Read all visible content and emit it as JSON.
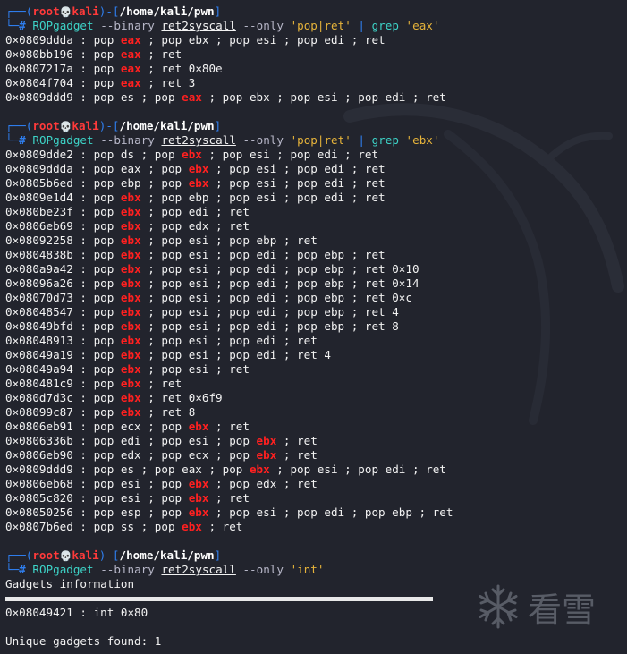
{
  "prompt": {
    "user": "root",
    "skull": "💀",
    "host": "kali",
    "path": "/home/kali/pwn",
    "top_prefix": "┌──(",
    "top_after_host": ")-[",
    "top_suffix": "]",
    "bottom_prefix": "└─",
    "hash": "#"
  },
  "commands": [
    {
      "program": "ROPgadget",
      "flag_binary": "--binary",
      "binary": "ret2syscall",
      "flag_only": "--only",
      "only_value": "'pop|ret'",
      "pipe": "|",
      "grep": "grep",
      "grep_value": "'eax'"
    },
    {
      "program": "ROPgadget",
      "flag_binary": "--binary",
      "binary": "ret2syscall",
      "flag_only": "--only",
      "only_value": "'pop|ret'",
      "pipe": "|",
      "grep": "grep",
      "grep_value": "'ebx'"
    },
    {
      "program": "ROPgadget",
      "flag_binary": "--binary",
      "binary": "ret2syscall",
      "flag_only": "--only",
      "only_value": "'int'"
    }
  ],
  "eax_results": [
    [
      "0×0809ddda : pop ",
      "eax",
      " ; pop ebx ; pop esi ; pop edi ; ret"
    ],
    [
      "0×080bb196 : pop ",
      "eax",
      " ; ret"
    ],
    [
      "0×0807217a : pop ",
      "eax",
      " ; ret 0×80e"
    ],
    [
      "0×0804f704 : pop ",
      "eax",
      " ; ret 3"
    ],
    [
      "0×0809ddd9 : pop es ; pop ",
      "eax",
      " ; pop ebx ; pop esi ; pop edi ; ret"
    ]
  ],
  "ebx_results": [
    [
      "0×0809dde2 : pop ds ; pop ",
      "ebx",
      " ; pop esi ; pop edi ; ret"
    ],
    [
      "0×0809ddda : pop eax ; pop ",
      "ebx",
      " ; pop esi ; pop edi ; ret"
    ],
    [
      "0×0805b6ed : pop ebp ; pop ",
      "ebx",
      " ; pop esi ; pop edi ; ret"
    ],
    [
      "0×0809e1d4 : pop ",
      "ebx",
      " ; pop ebp ; pop esi ; pop edi ; ret"
    ],
    [
      "0×080be23f : pop ",
      "ebx",
      " ; pop edi ; ret"
    ],
    [
      "0×0806eb69 : pop ",
      "ebx",
      " ; pop edx ; ret"
    ],
    [
      "0×08092258 : pop ",
      "ebx",
      " ; pop esi ; pop ebp ; ret"
    ],
    [
      "0×0804838b : pop ",
      "ebx",
      " ; pop esi ; pop edi ; pop ebp ; ret"
    ],
    [
      "0×080a9a42 : pop ",
      "ebx",
      " ; pop esi ; pop edi ; pop ebp ; ret 0×10"
    ],
    [
      "0×08096a26 : pop ",
      "ebx",
      " ; pop esi ; pop edi ; pop ebp ; ret 0×14"
    ],
    [
      "0×08070d73 : pop ",
      "ebx",
      " ; pop esi ; pop edi ; pop ebp ; ret 0×c"
    ],
    [
      "0×08048547 : pop ",
      "ebx",
      " ; pop esi ; pop edi ; pop ebp ; ret 4"
    ],
    [
      "0×08049bfd : pop ",
      "ebx",
      " ; pop esi ; pop edi ; pop ebp ; ret 8"
    ],
    [
      "0×08048913 : pop ",
      "ebx",
      " ; pop esi ; pop edi ; ret"
    ],
    [
      "0×08049a19 : pop ",
      "ebx",
      " ; pop esi ; pop edi ; ret 4"
    ],
    [
      "0×08049a94 : pop ",
      "ebx",
      " ; pop esi ; ret"
    ],
    [
      "0×080481c9 : pop ",
      "ebx",
      " ; ret"
    ],
    [
      "0×080d7d3c : pop ",
      "ebx",
      " ; ret 0×6f9"
    ],
    [
      "0×08099c87 : pop ",
      "ebx",
      " ; ret 8"
    ],
    [
      "0×0806eb91 : pop ecx ; pop ",
      "ebx",
      " ; ret"
    ],
    [
      "0×0806336b : pop edi ; pop esi ; pop ",
      "ebx",
      " ; ret"
    ],
    [
      "0×0806eb90 : pop edx ; pop ecx ; pop ",
      "ebx",
      " ; ret"
    ],
    [
      "0×0809ddd9 : pop es ; pop eax ; pop ",
      "ebx",
      " ; pop esi ; pop edi ; ret"
    ],
    [
      "0×0806eb68 : pop esi ; pop ",
      "ebx",
      " ; pop edx ; ret"
    ],
    [
      "0×0805c820 : pop esi ; pop ",
      "ebx",
      " ; ret"
    ],
    [
      "0×08050256 : pop esp ; pop ",
      "ebx",
      " ; pop esi ; pop edi ; pop ebp ; ret"
    ],
    [
      "0×0807b6ed : pop ss ; pop ",
      "ebx",
      " ; ret"
    ]
  ],
  "int_output": {
    "header": "Gadgets information",
    "result": "0×08049421 : int 0×80",
    "summary": "Unique gadgets found: 1"
  },
  "watermark": {
    "icon": "snowflake-icon",
    "text": "看雪"
  },
  "colors": {
    "background": "#22242d",
    "prompt_line": "#2f7ff0",
    "root": "#ff3a3a",
    "command": "#3dd4c8",
    "string": "#e6b33a",
    "highlight": "#ff2020"
  }
}
